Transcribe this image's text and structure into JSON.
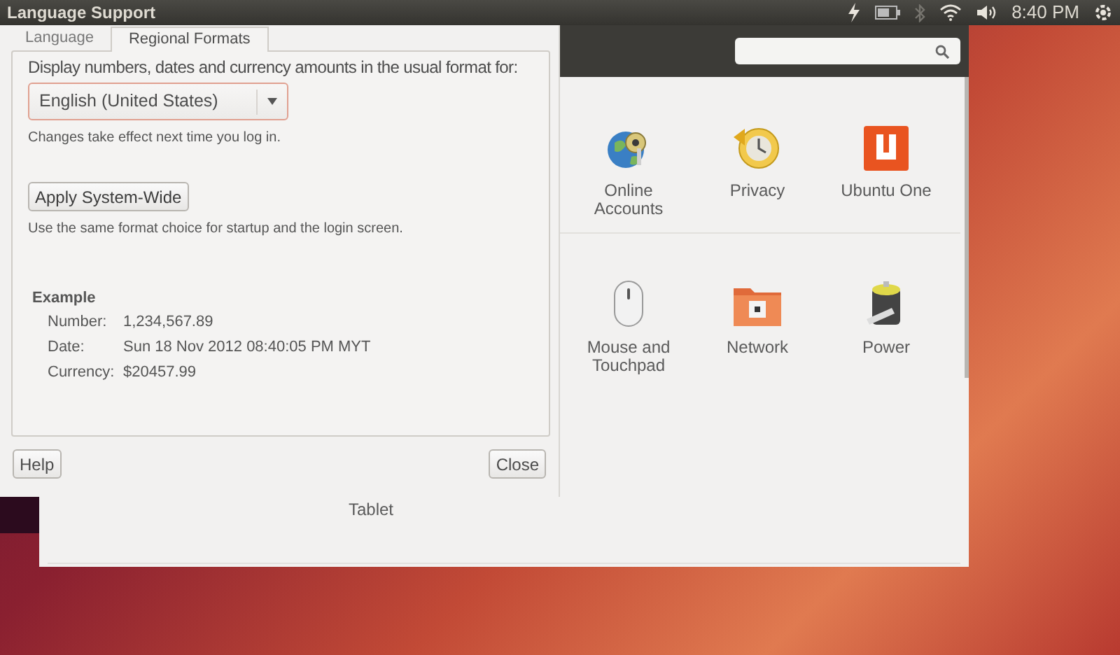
{
  "top_panel": {
    "title": "Language Support",
    "clock": "8:40 PM"
  },
  "settings_window": {
    "rows": [
      {
        "items": [
          {
            "label": "Online Accounts"
          },
          {
            "label": "Privacy"
          },
          {
            "label": "Ubuntu One"
          }
        ]
      },
      {
        "items": [
          {
            "label": "Mouse and Touchpad"
          },
          {
            "label": "Network"
          },
          {
            "label": "Power"
          }
        ]
      },
      {
        "items": [
          {
            "label": "Tablet"
          }
        ]
      }
    ]
  },
  "dialog": {
    "tabs": [
      {
        "label": "Language",
        "selected": false
      },
      {
        "label": "Regional Formats",
        "selected": true
      }
    ],
    "prompt": "Display numbers, dates and currency amounts in the usual format for:",
    "format_dropdown": {
      "value": "English (United States)"
    },
    "note": "Changes take effect next time you log in.",
    "apply_button": "Apply System-Wide",
    "apply_note": "Use the same format choice for startup and the login screen.",
    "example": {
      "heading": "Example",
      "rows": [
        {
          "label": "Number:",
          "value": "1,234,567.89"
        },
        {
          "label": "Date:",
          "value": "Sun 18 Nov 2012 08:40:05 PM MYT"
        },
        {
          "label": "Currency:",
          "value": "$20457.99"
        }
      ]
    },
    "buttons": [
      "Help",
      "Close"
    ]
  }
}
